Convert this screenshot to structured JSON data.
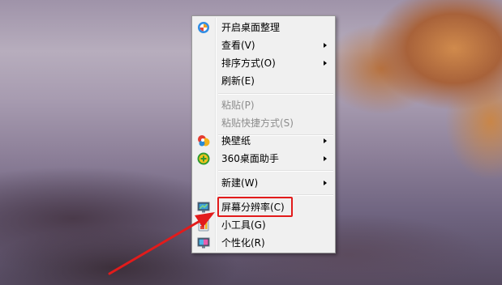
{
  "context_menu": {
    "items": [
      {
        "label": "开启桌面整理",
        "icon": "desktop-organizer-icon",
        "disabled": false,
        "submenu": false
      },
      {
        "label": "查看(V)",
        "disabled": false,
        "submenu": true
      },
      {
        "label": "排序方式(O)",
        "disabled": false,
        "submenu": true
      },
      {
        "label": "刷新(E)",
        "disabled": false,
        "submenu": false
      },
      {
        "label": "粘贴(P)",
        "disabled": true,
        "submenu": false
      },
      {
        "label": "粘贴快捷方式(S)",
        "disabled": true,
        "submenu": false
      },
      {
        "label": "换壁纸",
        "icon": "wallpaper-icon",
        "disabled": false,
        "submenu": true
      },
      {
        "label": "360桌面助手",
        "icon": "360-assistant-icon",
        "disabled": false,
        "submenu": true
      },
      {
        "label": "新建(W)",
        "disabled": false,
        "submenu": true
      },
      {
        "label": "屏幕分辨率(C)",
        "icon": "screen-resolution-icon",
        "disabled": false,
        "submenu": false
      },
      {
        "label": "小工具(G)",
        "icon": "gadgets-icon",
        "disabled": false,
        "submenu": false
      },
      {
        "label": "个性化(R)",
        "icon": "personalize-icon",
        "disabled": false,
        "submenu": false
      }
    ]
  },
  "annotation": {
    "highlight_color": "#e21b1b",
    "highlighted_item": "屏幕分辨率(C)"
  }
}
